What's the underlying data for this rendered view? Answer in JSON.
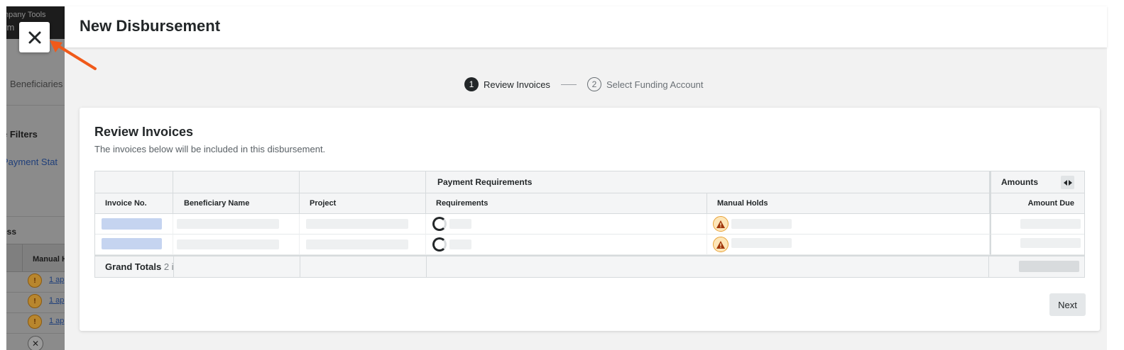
{
  "background": {
    "company_tools": "mpany Tools",
    "pay_partial": "ym",
    "tab_beneficiaries": "Beneficiaries",
    "filters": "e Filters",
    "payment_status": "Payment Stat",
    "section_partial": "ess",
    "manual_holds_partial": "Manual H",
    "row_link": "1 ap",
    "row_icon": "warning-icon"
  },
  "close_button": {
    "icon": "close-icon"
  },
  "annotation": {
    "arrow_color": "#f05a1a"
  },
  "modal": {
    "title": "New Disbursement"
  },
  "stepper": {
    "steps": [
      {
        "number": "1",
        "label": "Review Invoices",
        "state": "active"
      },
      {
        "number": "2",
        "label": "Select Funding Account",
        "state": "inactive"
      }
    ]
  },
  "card": {
    "title": "Review Invoices",
    "subtitle": "The invoices below will be included in this disbursement."
  },
  "table": {
    "group_headers": {
      "payment_requirements": "Payment Requirements",
      "amounts": "Amounts"
    },
    "columns": {
      "invoice_no": "Invoice No.",
      "beneficiary_name": "Beneficiary Name",
      "project": "Project",
      "requirements": "Requirements",
      "manual_holds": "Manual Holds",
      "amount_due": "Amount Due"
    },
    "rows_state": "loading",
    "row_count_visible": 2,
    "totals": {
      "label": "Grand Totals",
      "count_partial": "2 i"
    }
  },
  "footer": {
    "next_label": "Next"
  },
  "colors": {
    "accent_dark": "#232729",
    "skeleton_blue": "#c5d4f0",
    "warning_fill": "#fde6b8",
    "warning_border": "#e8a33a"
  }
}
